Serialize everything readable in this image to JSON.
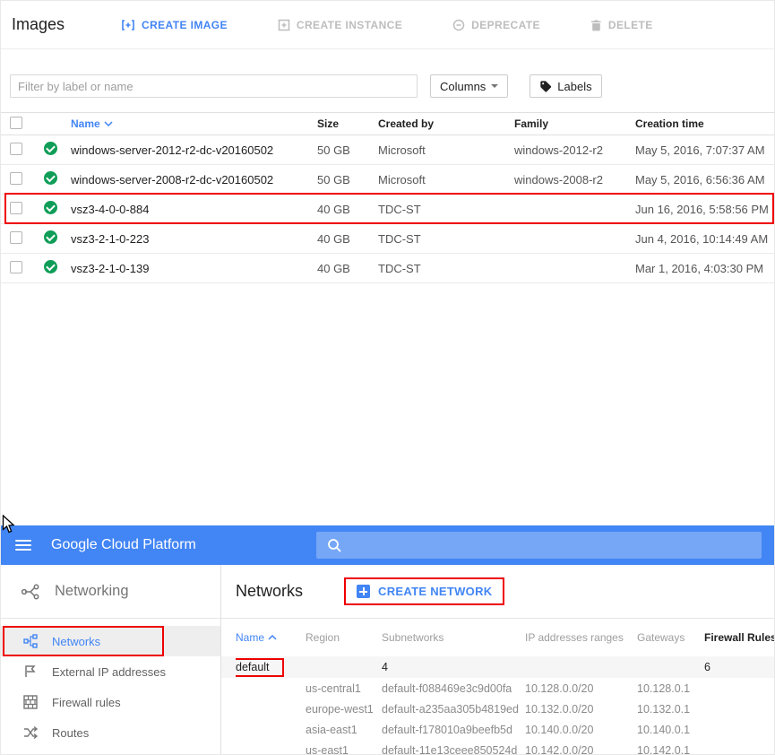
{
  "colors": {
    "blue": "#4285f4",
    "green": "#0f9d58",
    "red_annotation": "#ee0000"
  },
  "images": {
    "title": "Images",
    "toolbar": {
      "create_image": "CREATE IMAGE",
      "create_instance": "CREATE INSTANCE",
      "deprecate": "DEPRECATE",
      "delete": "DELETE"
    },
    "filter_placeholder": "Filter by label or name",
    "columns_label": "Columns",
    "labels_label": "Labels",
    "table": {
      "headers": {
        "name": "Name",
        "size": "Size",
        "created_by": "Created by",
        "family": "Family",
        "creation_time": "Creation time"
      },
      "rows": [
        {
          "name": "windows-server-2012-r2-dc-v20160502",
          "size": "50 GB",
          "created_by": "Microsoft",
          "family": "windows-2012-r2",
          "creation_time": "May 5, 2016, 7:07:37 AM"
        },
        {
          "name": "windows-server-2008-r2-dc-v20160502",
          "size": "50 GB",
          "created_by": "Microsoft",
          "family": "windows-2008-r2",
          "creation_time": "May 5, 2016, 6:56:36 AM"
        },
        {
          "name": "vsz3-4-0-0-884",
          "size": "40 GB",
          "created_by": "TDC-ST",
          "family": "",
          "creation_time": "Jun 16, 2016, 5:58:56 PM"
        },
        {
          "name": "vsz3-2-1-0-223",
          "size": "40 GB",
          "created_by": "TDC-ST",
          "family": "",
          "creation_time": "Jun 4, 2016, 10:14:49 AM"
        },
        {
          "name": "vsz3-2-1-0-139",
          "size": "40 GB",
          "created_by": "TDC-ST",
          "family": "",
          "creation_time": "Mar 1, 2016, 4:03:30 PM"
        }
      ]
    }
  },
  "gcp": {
    "brand": "Google Cloud Platform",
    "sidebar": {
      "title": "Networking",
      "items": [
        {
          "label": "Networks"
        },
        {
          "label": "External IP addresses"
        },
        {
          "label": "Firewall rules"
        },
        {
          "label": "Routes"
        }
      ]
    },
    "main": {
      "title": "Networks",
      "create_button": "CREATE NETWORK",
      "table": {
        "headers": {
          "name": "Name",
          "region": "Region",
          "subnetworks": "Subnetworks",
          "ip_ranges": "IP addresses ranges",
          "gateways": "Gateways",
          "firewall_rules": "Firewall Rules"
        },
        "rows": [
          {
            "name": "default",
            "region": "",
            "subnetworks": "4",
            "ip": "",
            "gateway": "",
            "firewall": "6"
          },
          {
            "name": "",
            "region": "us-central1",
            "subnetworks": "default-f088469e3c9d00fa",
            "ip": "10.128.0.0/20",
            "gateway": "10.128.0.1",
            "firewall": ""
          },
          {
            "name": "",
            "region": "europe-west1",
            "subnetworks": "default-a235aa305b4819ed",
            "ip": "10.132.0.0/20",
            "gateway": "10.132.0.1",
            "firewall": ""
          },
          {
            "name": "",
            "region": "asia-east1",
            "subnetworks": "default-f178010a9beefb5d",
            "ip": "10.140.0.0/20",
            "gateway": "10.140.0.1",
            "firewall": ""
          },
          {
            "name": "",
            "region": "us-east1",
            "subnetworks": "default-11e13ceee850524d",
            "ip": "10.142.0.0/20",
            "gateway": "10.142.0.1",
            "firewall": ""
          }
        ]
      }
    }
  }
}
